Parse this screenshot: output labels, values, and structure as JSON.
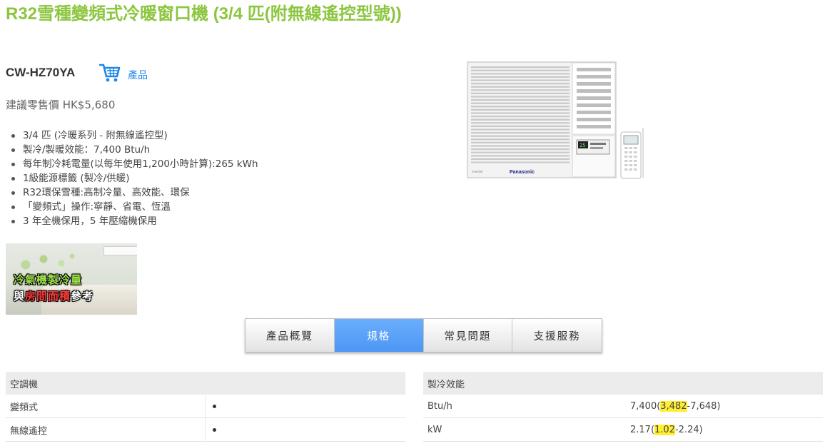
{
  "product": {
    "title": "R32雪種變頻式冷暖窗口機 (3/4 匹(附無線遙控型號))",
    "model": "CW-HZ70YA",
    "cart_label": "產品",
    "price": "建議零售價 HK$5,680",
    "image_brand": "Panasonic",
    "remote_temp": "25",
    "features": [
      "3/4 匹 (冷暖系列 - 附無線遙控型)",
      "製冷/製暖效能：7,400 Btu/h",
      "每年制冷耗電量(以每年使用1,200小時計算):265 kWh",
      "1級能源標籤 (製冷/供暖)",
      "R32環保雪種:高制冷量、高效能、環保",
      "「變頻式」操作:寧靜、省電、恆溫",
      "3 年全機保用，5 年壓縮機保用"
    ]
  },
  "promo": {
    "line1": "冷氣機製冷量",
    "line2_prefix": "與",
    "line2_highlight": "房間面積",
    "line2_suffix": "參考"
  },
  "tabs": [
    {
      "label": "產品概覽",
      "active": false
    },
    {
      "label": "規格",
      "active": true
    },
    {
      "label": "常見問題",
      "active": false
    },
    {
      "label": "支援服務",
      "active": false
    }
  ],
  "spec_left": {
    "header": "空調機",
    "rows": [
      {
        "label": "變頻式",
        "value": "●"
      },
      {
        "label": "無線遙控",
        "value": "●"
      }
    ]
  },
  "spec_right": {
    "header": "製冷效能",
    "rows": [
      {
        "label": "Btu/h",
        "value_prefix": "7,400(",
        "value_mark": "3,482",
        "value_suffix": "-7,648)"
      },
      {
        "label": "kW",
        "value_prefix": "2.17(",
        "value_mark": "1.02",
        "value_suffix": "-2.24)"
      }
    ]
  },
  "colors": {
    "title": "#8cc63f",
    "tab_active": "#4d96f5",
    "link": "#1e88e5",
    "highlight": "#ffee33"
  },
  "icons": {
    "cart": "shopping-cart-icon"
  }
}
